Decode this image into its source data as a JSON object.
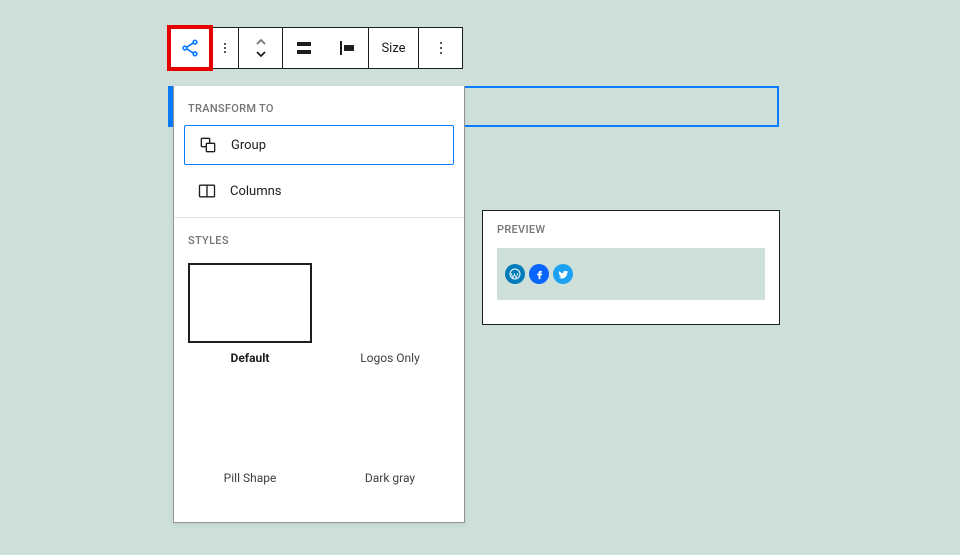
{
  "toolbar": {
    "size_label": "Size"
  },
  "transform": {
    "header": "TRANSFORM TO",
    "items": [
      {
        "label": "Group",
        "icon": "group-icon"
      },
      {
        "label": "Columns",
        "icon": "columns-icon"
      }
    ]
  },
  "styles": {
    "header": "STYLES",
    "options": [
      {
        "label": "Default",
        "selected": true
      },
      {
        "label": "Logos Only",
        "selected": false
      },
      {
        "label": "Pill Shape",
        "selected": false
      },
      {
        "label": "Dark gray",
        "selected": false
      }
    ]
  },
  "preview": {
    "header": "PREVIEW",
    "social_icons": [
      "wordpress",
      "facebook",
      "twitter"
    ]
  }
}
